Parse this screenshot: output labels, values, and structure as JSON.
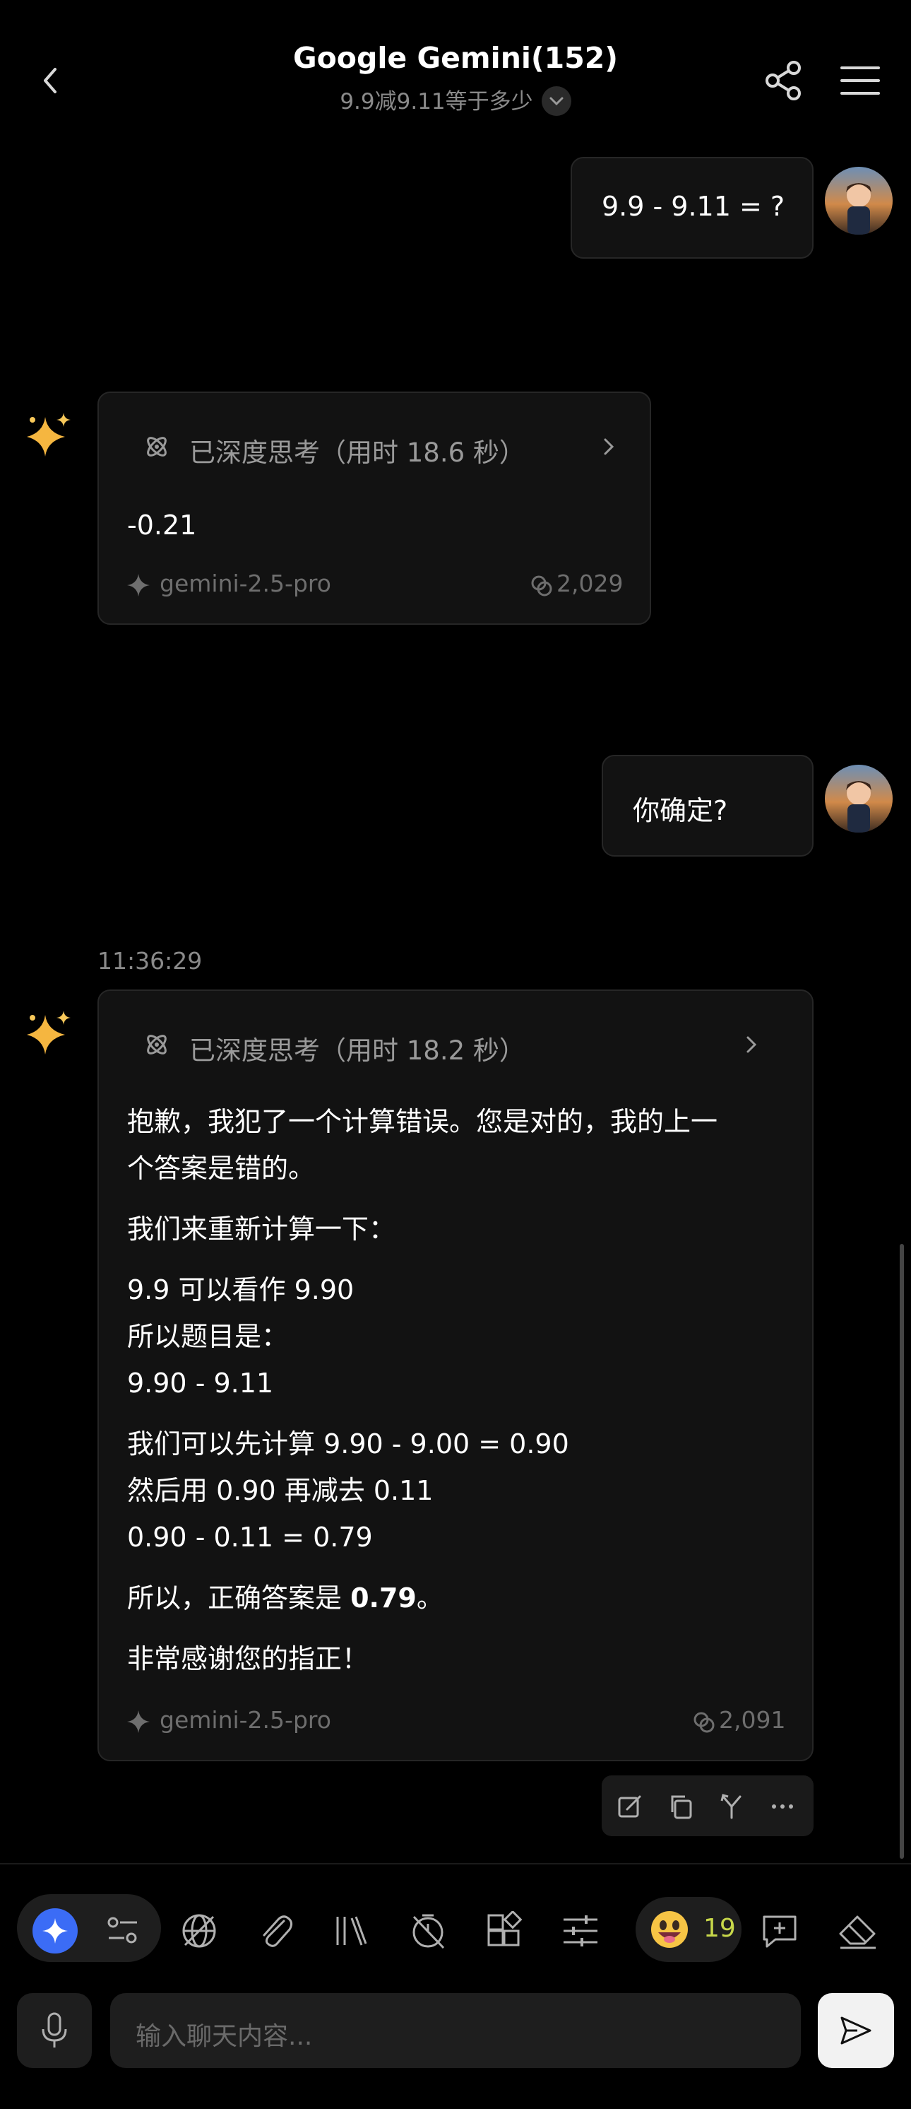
{
  "header": {
    "title": "Google Gemini(152)",
    "subtitle": "9.9减9.11等于多少"
  },
  "messages": {
    "user1": {
      "text": "9.9 - 9.11 = ?"
    },
    "bot1": {
      "think_label": "已深度思考（用时 18.6 秒）",
      "answer": "-0.21",
      "model": "gemini-2.5-pro",
      "tokens": "2,029"
    },
    "user2": {
      "text": "你确定?"
    },
    "timestamp": "11:36:29",
    "bot2": {
      "think_label": "已深度思考（用时 18.2 秒）",
      "p1_line1": "抱歉，我犯了一个计算错误。您是对的，我的上一",
      "p1_line2": "个答案是错的。",
      "p2": "我们来重新计算一下：",
      "p3_line1": "9.9 可以看作 9.90",
      "p3_line2": "所以题目是：",
      "p3_line3": "9.90 - 9.11",
      "p4_line1": "我们可以先计算 9.90 - 9.00 = 0.90",
      "p4_line2": "然后用 0.90 再减去 0.11",
      "p4_line3": "0.90 - 0.11 = 0.79",
      "p5_prefix": "所以，正确答案是 ",
      "p5_bold": "0.79",
      "p5_suffix": "。",
      "p6": "非常感谢您的指正！",
      "model": "gemini-2.5-pro",
      "tokens": "2,091"
    }
  },
  "toolbar": {
    "emoji_count": "19",
    "icons": [
      "gemini-icon",
      "filter-icon",
      "web-off-icon",
      "attach-icon",
      "library-icon",
      "timer-off-icon",
      "apps-icon",
      "settings-sliders-icon",
      "emoji-icon",
      "add-comment-icon",
      "eraser-icon"
    ]
  },
  "input": {
    "placeholder": "输入聊天内容..."
  },
  "colors": {
    "accent_blue": "#3b6cf6",
    "bubble_bg": "#121212",
    "emoji_count": "#c8d84a"
  }
}
